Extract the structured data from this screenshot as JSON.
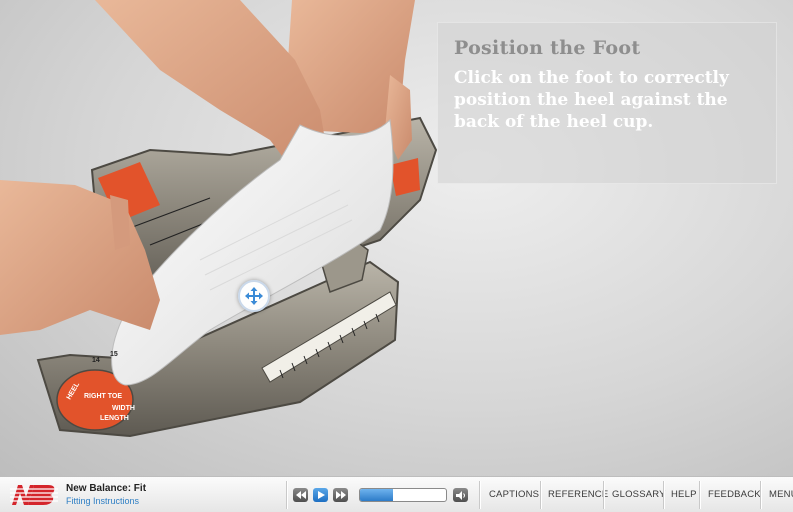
{
  "slide": {
    "title": "Position the Foot",
    "instruction": "Click on the foot to correctly position the heel against the back of the heel cup."
  },
  "player": {
    "course_title": "New Balance: Fit",
    "lesson_title": "Fitting Instructions",
    "progress_percent": 38,
    "menu": {
      "captions": "CAPTIONS",
      "reference": "REFERENCE",
      "glossary": "GLOSSARY",
      "help": "HELP",
      "feedback": "FEEDBACK",
      "menu": "MENU"
    }
  },
  "device_labels": {
    "heel": "HEEL",
    "right_toe": "RIGHT TOE",
    "length": "LENGTH",
    "width": "WIDTH",
    "size_14": "14",
    "size_15": "15"
  },
  "icons": {
    "logo": "new-balance-logo",
    "move": "move-arrows-icon",
    "rewind": "rewind-icon",
    "play": "play-icon",
    "forward": "forward-icon",
    "volume": "volume-icon"
  },
  "colors": {
    "accent_blue": "#2d7cc8",
    "brand_red": "#d4252b",
    "device_orange": "#e2532b"
  }
}
